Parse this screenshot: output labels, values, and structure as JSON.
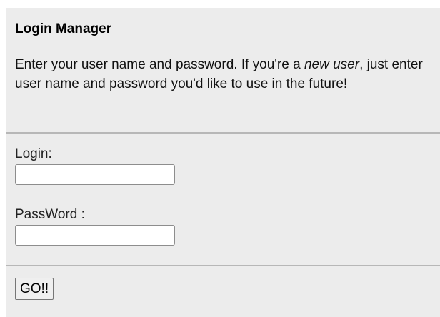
{
  "login_manager": {
    "title": "Login Manager",
    "intro_before": "Enter your user name and password. If you're a ",
    "intro_emphasis": "new user",
    "intro_after": ", just enter user name and password you'd like to use in the future!",
    "login_label": "Login:",
    "login_value": "",
    "password_label": "PassWord :",
    "password_value": "",
    "go_label": "GO!!"
  }
}
